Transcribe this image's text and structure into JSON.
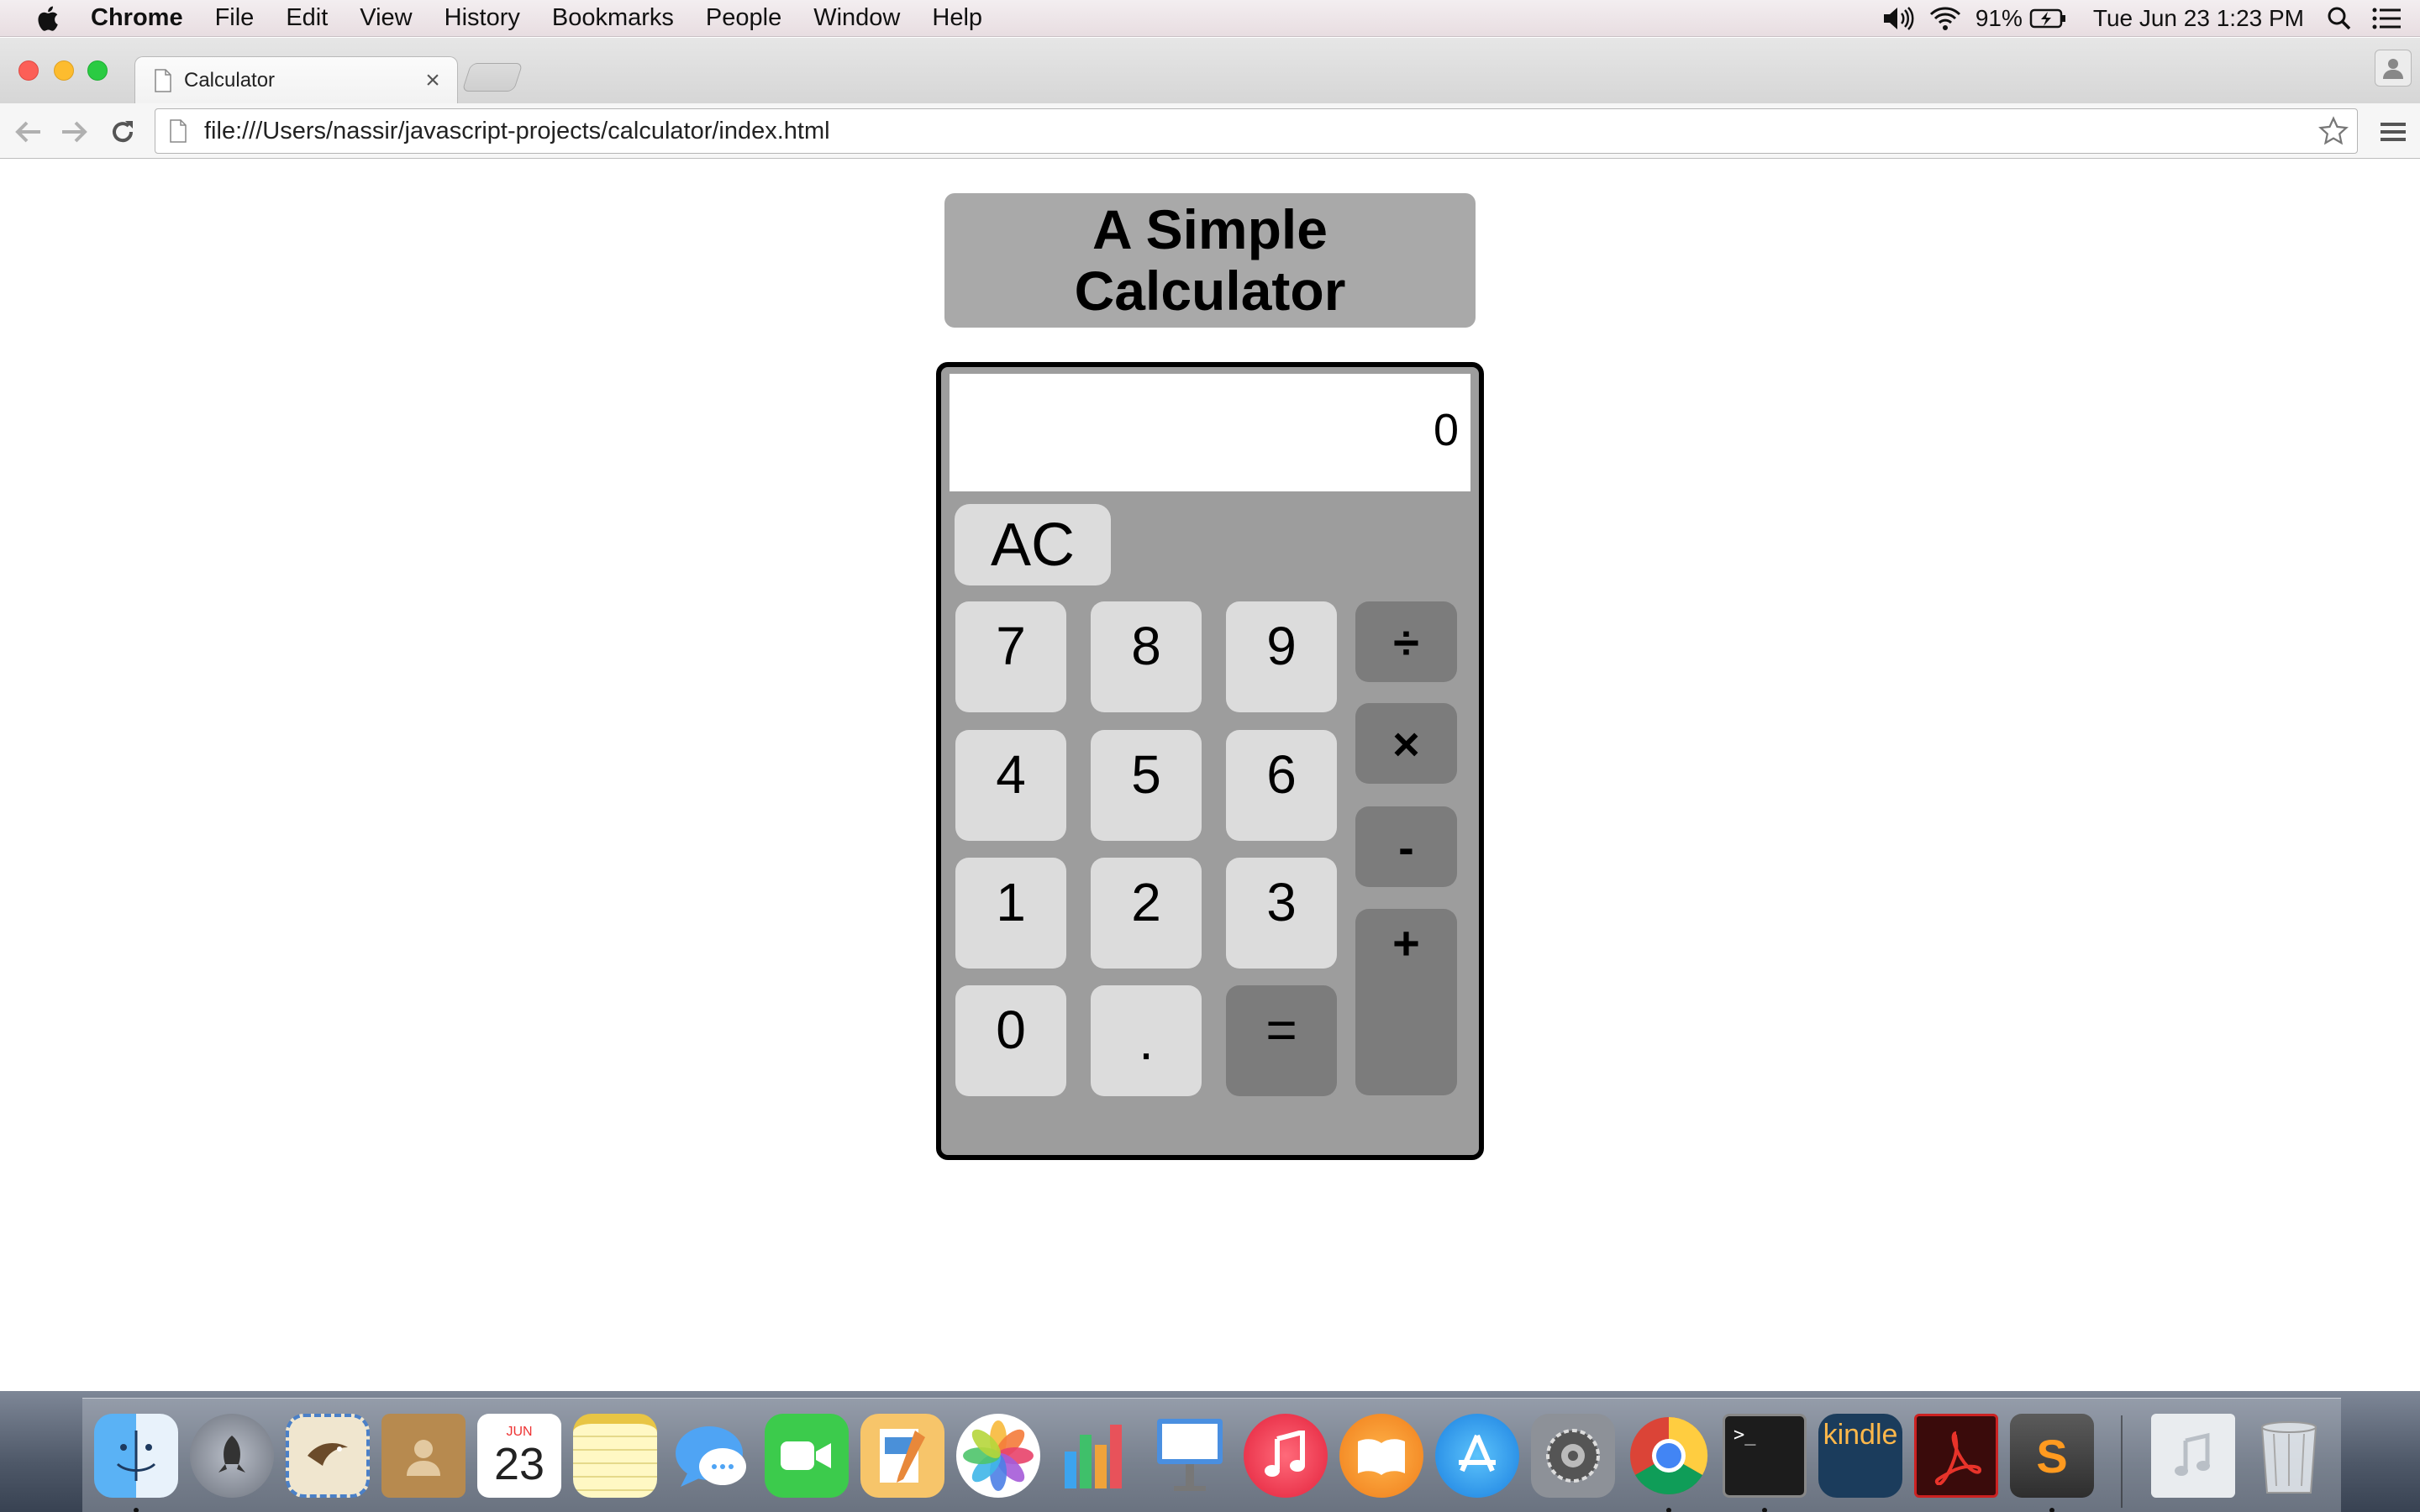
{
  "menubar": {
    "app_name": "Chrome",
    "items": [
      "File",
      "Edit",
      "View",
      "History",
      "Bookmarks",
      "People",
      "Window",
      "Help"
    ],
    "battery": "91%",
    "datetime": "Tue Jun 23  1:23 PM"
  },
  "browser": {
    "tab_title": "Calculator",
    "tab_close": "×",
    "url": "file:///Users/nassir/javascript-projects/calculator/index.html"
  },
  "page": {
    "title": "A Simple Calculator",
    "display_value": "0",
    "buttons": {
      "clear": "AC",
      "seven": "7",
      "eight": "8",
      "nine": "9",
      "four": "4",
      "five": "5",
      "six": "6",
      "one": "1",
      "two": "2",
      "three": "3",
      "zero": "0",
      "decimal": ".",
      "equals": "=",
      "divide": "÷",
      "multiply": "×",
      "subtract": "-",
      "add": "+"
    }
  },
  "dock": {
    "apps": [
      "Finder",
      "Launchpad",
      "Mail",
      "Contacts",
      "Calendar",
      "Notes",
      "Messages",
      "FaceTime",
      "Pages",
      "Photos",
      "Numbers",
      "Keynote",
      "iTunes",
      "iBooks",
      "App Store",
      "System Preferences",
      "Google Chrome",
      "Terminal",
      "Kindle",
      "Adobe Acrobat",
      "Sublime Text",
      "Music Folder",
      "Trash"
    ],
    "calendar_month": "JUN",
    "calendar_day": "23",
    "kindle_label": "kindle",
    "terminal_prompt": ">_",
    "sublime_letter": "S"
  }
}
